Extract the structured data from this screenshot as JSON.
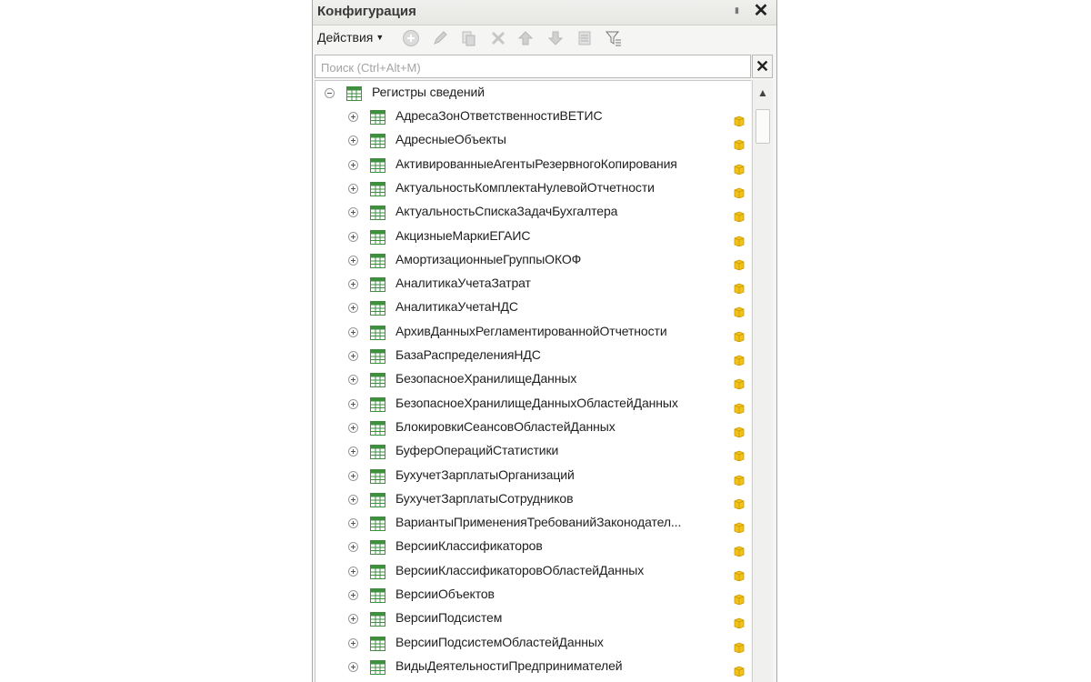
{
  "panel": {
    "title": "Конфигурация",
    "close_glyph": "✕",
    "pin_glyph": "▮"
  },
  "toolbar": {
    "actions_label": "Действия",
    "buttons": [
      "add-icon",
      "edit-icon",
      "copy-icon",
      "delete-icon",
      "move-up-icon",
      "move-down-icon",
      "sort-icon",
      "filter-icon"
    ]
  },
  "search": {
    "placeholder": "Поиск (Ctrl+Alt+M)",
    "value": "",
    "clear_glyph": "✕"
  },
  "tree": {
    "root_label": "Регистры сведений",
    "items": [
      "АдресаЗонОтветственностиВЕТИС",
      "АдресныеОбъекты",
      "АктивированныеАгентыРезервногоКопирования",
      "АктуальностьКомплектаНулевойОтчетности",
      "АктуальностьСпискаЗадачБухгалтера",
      "АкцизныеМаркиЕГАИС",
      "АмортизационныеГруппыОКОФ",
      "АналитикаУчетаЗатрат",
      "АналитикаУчетаНДС",
      "АрхивДанныхРегламентированнойОтчетности",
      "БазаРаспределенияНДС",
      "БезопасноеХранилищеДанных",
      "БезопасноеХранилищеДанныхОбластейДанных",
      "БлокировкиСеансовОбластейДанных",
      "БуферОперацийСтатистики",
      "БухучетЗарплатыОрганизаций",
      "БухучетЗарплатыСотрудников",
      "ВариантыПримененияТребованийЗаконодател...",
      "ВерсииКлассификаторов",
      "ВерсииКлассификаторовОбластейДанных",
      "ВерсииОбъектов",
      "ВерсииПодсистем",
      "ВерсииПодсистемОбластейДанных",
      "ВидыДеятельностиПредпринимателей"
    ]
  },
  "scrollbar": {
    "up_glyph": "▲"
  },
  "colors": {
    "panel_bg": "#f5f5f3",
    "icon_green": "#3f8f3f",
    "cube_yellow": "#f2c21a"
  }
}
